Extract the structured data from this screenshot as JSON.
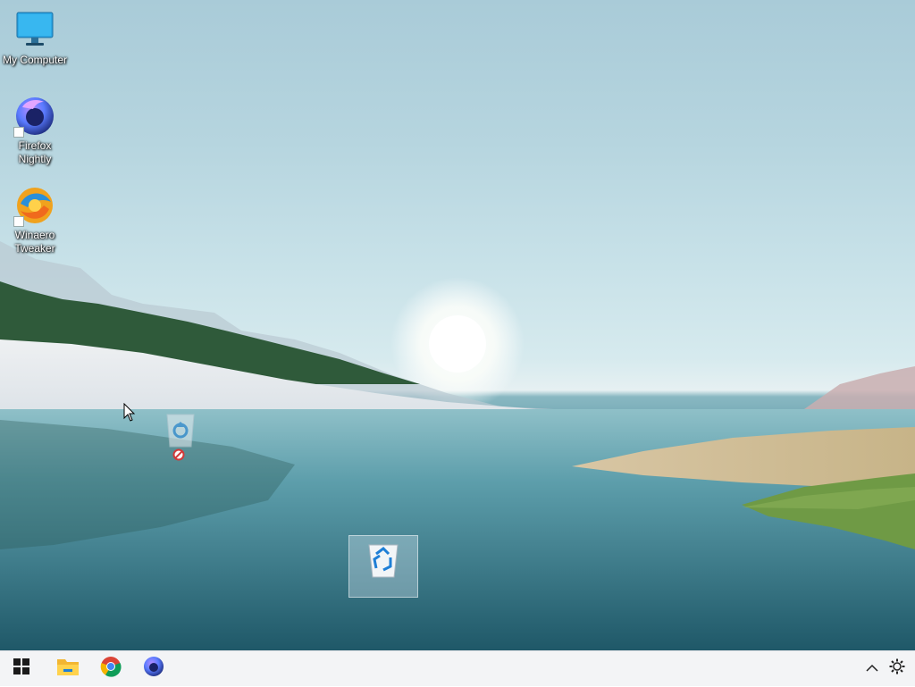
{
  "desktop": {
    "icons": [
      {
        "label": "My Computer",
        "icon": "monitor-icon"
      },
      {
        "label": "Firefox Nightly",
        "icon": "firefox-nightly-icon",
        "shortcut": true
      },
      {
        "label": "Winaero Tweaker",
        "icon": "winaero-tweaker-icon",
        "shortcut": true
      }
    ],
    "drag_ghost": {
      "icon": "recycle-bin-icon",
      "drop_state": "not-allowed-icon"
    },
    "selected_icon": {
      "icon": "recycle-bin-icon",
      "selected": true
    }
  },
  "taskbar": {
    "start": {
      "icon": "windows-start-icon"
    },
    "pinned": [
      {
        "icon": "file-explorer-icon"
      },
      {
        "icon": "chrome-icon"
      },
      {
        "icon": "firefox-nightly-icon"
      }
    ],
    "tray": [
      {
        "icon": "chevron-up-icon"
      },
      {
        "icon": "gear-icon"
      }
    ]
  },
  "colors": {
    "taskbar_bg": "#f3f4f6",
    "recycle_blue": "#1f7fd6",
    "selection": "rgba(220,235,245,0.35)"
  }
}
